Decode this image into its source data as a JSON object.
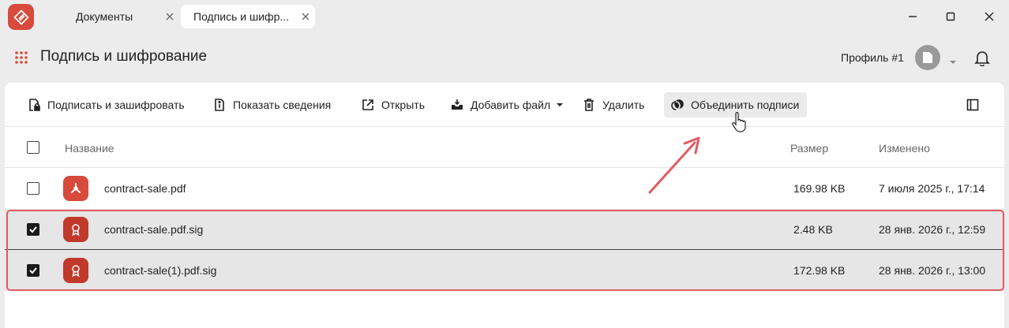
{
  "window": {
    "tabs": [
      {
        "label": "Документы",
        "active": false
      },
      {
        "label": "Подпись и шифр...",
        "active": true
      }
    ],
    "controls": [
      "minimize-icon",
      "maximize-icon",
      "close-icon"
    ]
  },
  "header": {
    "title": "Подпись и шифрование",
    "profile": "Профиль #1"
  },
  "toolbar": {
    "sign_encrypt": "Подписать и зашифровать",
    "show_info": "Показать сведения",
    "open": "Открыть",
    "add_file": "Добавить файл",
    "delete": "Удалить",
    "merge_signatures": "Объединить подписи"
  },
  "table": {
    "columns": {
      "name": "Название",
      "size": "Размер",
      "modified": "Изменено"
    },
    "rows": [
      {
        "name": "contract-sale.pdf",
        "size": "169.98 KB",
        "modified": "7 июля 2025 г., 17:14",
        "type": "pdf",
        "checked": false
      },
      {
        "name": "contract-sale.pdf.sig",
        "size": "2.48 KB",
        "modified": "28 янв. 2026 г., 12:59",
        "type": "sig",
        "checked": true
      },
      {
        "name": "contract-sale(1).pdf.sig",
        "size": "172.98 KB",
        "modified": "28 янв. 2026 г., 13:00",
        "type": "sig",
        "checked": true
      }
    ]
  },
  "colors": {
    "accent": "#d84a3c",
    "annotation": "#e05a63",
    "selected_row": "#e6e6e6"
  }
}
